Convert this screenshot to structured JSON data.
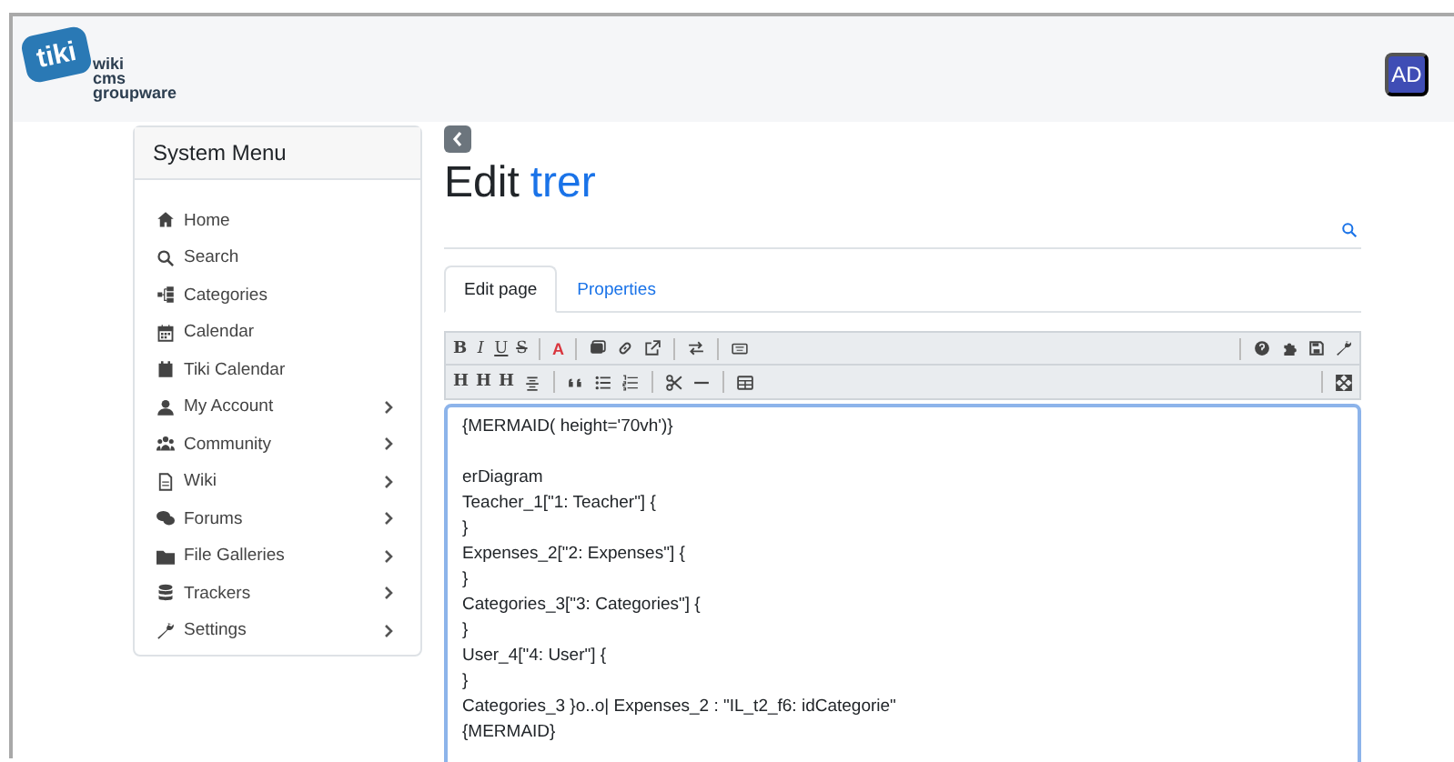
{
  "header": {
    "logo": {
      "mark": "tiki",
      "lines": [
        "wiki",
        "cms",
        "groupware"
      ]
    },
    "avatar": "AD"
  },
  "sidebar": {
    "title": "System Menu",
    "items": [
      {
        "kind": "home",
        "label": "Home",
        "has_submenu": false
      },
      {
        "kind": "search",
        "label": "Search",
        "has_submenu": false
      },
      {
        "kind": "tree",
        "label": "Categories",
        "has_submenu": false
      },
      {
        "kind": "calendar",
        "label": "Calendar",
        "has_submenu": false
      },
      {
        "kind": "calendarsolid",
        "label": "Tiki Calendar",
        "has_submenu": false
      },
      {
        "kind": "user",
        "label": "My Account",
        "has_submenu": true
      },
      {
        "kind": "users",
        "label": "Community",
        "has_submenu": true
      },
      {
        "kind": "file",
        "label": "Wiki",
        "has_submenu": true
      },
      {
        "kind": "comments",
        "label": "Forums",
        "has_submenu": true
      },
      {
        "kind": "folder",
        "label": "File Galleries",
        "has_submenu": true
      },
      {
        "kind": "database",
        "label": "Trackers",
        "has_submenu": true
      },
      {
        "kind": "wrench",
        "label": "Settings",
        "has_submenu": true
      }
    ]
  },
  "page": {
    "title_prefix": "Edit",
    "title_name": "trer",
    "tabs": [
      {
        "label": "Edit page",
        "selected": true
      },
      {
        "label": "Properties",
        "selected": false
      }
    ],
    "toolbar_rows": [
      {
        "left": [
          {
            "kind": "bold",
            "text": "B"
          },
          {
            "kind": "italic",
            "text": "I"
          },
          {
            "kind": "underline",
            "text": "U"
          },
          {
            "kind": "strike",
            "text": "S"
          },
          {
            "kind": "separator"
          },
          {
            "kind": "color",
            "text": "A"
          },
          {
            "kind": "separator"
          },
          {
            "kind": "image"
          },
          {
            "kind": "link"
          },
          {
            "kind": "external"
          },
          {
            "kind": "separator"
          },
          {
            "kind": "swap"
          },
          {
            "kind": "separator"
          },
          {
            "kind": "keyboard"
          }
        ],
        "right": [
          {
            "kind": "separator"
          },
          {
            "kind": "help"
          },
          {
            "kind": "puzzle"
          },
          {
            "kind": "save"
          },
          {
            "kind": "wrench"
          }
        ]
      },
      {
        "left": [
          {
            "kind": "bold",
            "text": "H"
          },
          {
            "kind": "bold",
            "text": "H"
          },
          {
            "kind": "bold",
            "text": "H"
          },
          {
            "kind": "align"
          },
          {
            "kind": "separator"
          },
          {
            "kind": "quote"
          },
          {
            "kind": "list"
          },
          {
            "kind": "numlist"
          },
          {
            "kind": "separator"
          },
          {
            "kind": "scissors"
          },
          {
            "kind": "rule"
          },
          {
            "kind": "separator"
          },
          {
            "kind": "table"
          }
        ],
        "right": [
          {
            "kind": "separator"
          },
          {
            "kind": "fullscreen"
          }
        ]
      }
    ],
    "editor_blocks": [
      [
        "{MERMAID( height='70vh')}"
      ],
      [
        "erDiagram",
        "Teacher_1[\"1: Teacher\"] {",
        "}",
        "Expenses_2[\"2: Expenses\"] {",
        "}",
        "Categories_3[\"3: Categories\"] {",
        "}",
        "User_4[\"4: User\"] {",
        "}",
        "Categories_3 }o..o| Expenses_2 : \"IL_t2_f6: idCategorie\"",
        "{MERMAID}"
      ]
    ]
  }
}
